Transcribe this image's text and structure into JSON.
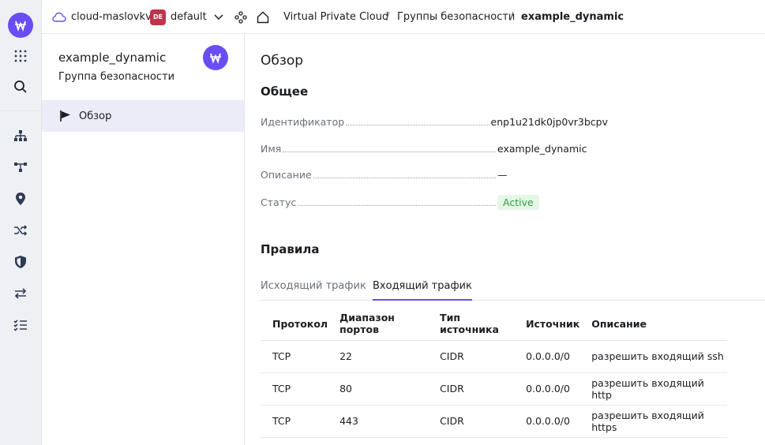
{
  "rail": {
    "icons": [
      "logo-icon",
      "apps-grid-icon",
      "search-icon",
      "network-icon",
      "topology-icon",
      "location-pin-icon",
      "shuffle-icon",
      "shield-icon",
      "transfer-icon",
      "checklist-icon"
    ]
  },
  "topbar": {
    "cloud_name": "cloud-maslovkv",
    "folder_badge": "DE",
    "folder_name": "default",
    "breadcrumb": [
      "Virtual Private Cloud",
      "Группы безопасности",
      "example_dynamic"
    ],
    "separator": "/"
  },
  "panel": {
    "title": "example_dynamic",
    "subtitle": "Группа безопасности",
    "nav_item": "Обзор"
  },
  "main": {
    "heading": "Обзор",
    "general_heading": "Общее",
    "fields": [
      {
        "key": "Идентификатор",
        "value": "enp1u21dk0jp0vr3bcpv"
      },
      {
        "key": "Имя",
        "value": "example_dynamic"
      },
      {
        "key": "Описание",
        "value": "—"
      },
      {
        "key": "Статус",
        "value": "Active"
      }
    ],
    "rules_heading": "Правила",
    "tabs": [
      "Исходящий трафик",
      "Входящий трафик"
    ],
    "active_tab": "Входящий трафик",
    "table": {
      "headers": [
        "Протокол",
        "Диапазон портов",
        "Тип источника",
        "Источник",
        "Описание"
      ],
      "rows": [
        [
          "TCP",
          "22",
          "CIDR",
          "0.0.0.0/0",
          "разрешить входящий ssh"
        ],
        [
          "TCP",
          "80",
          "CIDR",
          "0.0.0.0/0",
          "разрешить входящий http"
        ],
        [
          "TCP",
          "443",
          "CIDR",
          "0.0.0.0/0",
          "разрешить входящий https"
        ]
      ]
    }
  },
  "colors": {
    "accent": "#6a4df4",
    "status_active_bg": "#e5f5e7",
    "status_active_text": "#2f9f3e",
    "folder_badge": "#c0334b"
  }
}
